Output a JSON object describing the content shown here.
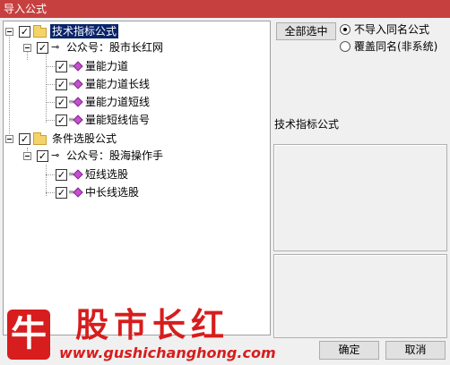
{
  "window": {
    "title": "导入公式"
  },
  "tree": {
    "root1": {
      "label": "技术指标公式",
      "checked": "✓"
    },
    "root1_child": {
      "label": "公众号：股市长红网",
      "checked": "✓"
    },
    "root1_items": [
      {
        "label": "量能力道",
        "checked": "✓"
      },
      {
        "label": "量能力道长线",
        "checked": "✓"
      },
      {
        "label": "量能力道短线",
        "checked": "✓"
      },
      {
        "label": "量能短线信号",
        "checked": "✓"
      }
    ],
    "root2": {
      "label": "条件选股公式",
      "checked": "✓"
    },
    "root2_child": {
      "label": "公众号：股海操作手",
      "checked": "✓"
    },
    "root2_items": [
      {
        "label": "短线选股",
        "checked": "✓"
      },
      {
        "label": "中长线选股",
        "checked": "✓"
      }
    ]
  },
  "right": {
    "select_all": "全部选中",
    "radio_no_import": "不导入同名公式",
    "radio_overwrite": "覆盖同名(非系统)",
    "info_title": "技术指标公式"
  },
  "footer": {
    "ok": "确定",
    "cancel": "取消",
    "logo_char": "牛",
    "brand": "股市长红",
    "url": "www.gushichanghong.com"
  }
}
